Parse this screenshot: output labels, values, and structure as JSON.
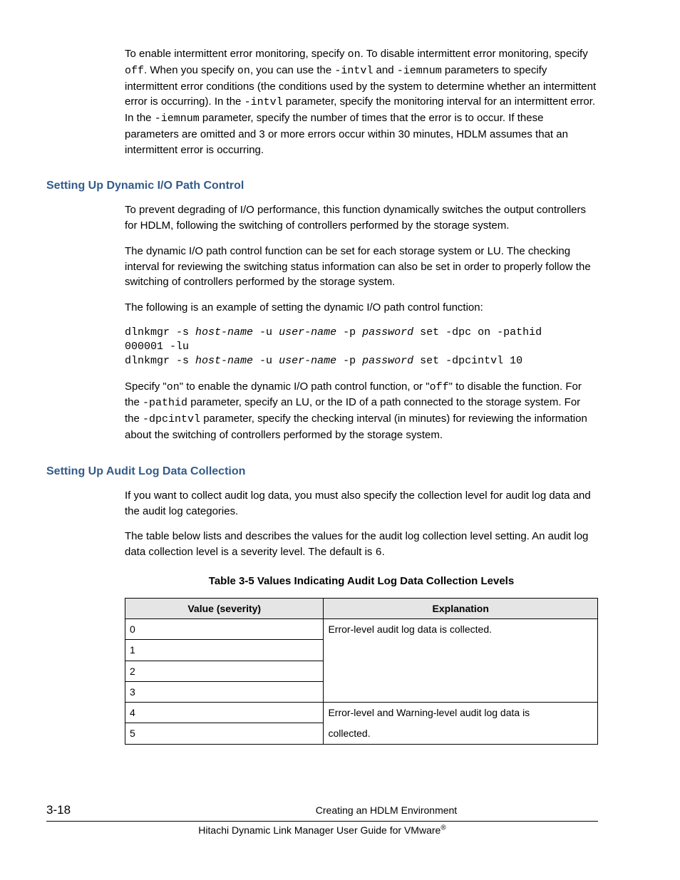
{
  "para1_parts": {
    "t1": "To enable intermittent error monitoring, specify ",
    "c1": "on",
    "t2": ". To disable intermittent error monitoring, specify ",
    "c2": "off",
    "t3": ". When you specify ",
    "c3": "on",
    "t4": ", you can use the ",
    "c4": "-intvl",
    "t5": " and ",
    "c5": "-iemnum",
    "t6": " parameters to specify intermittent error conditions (the conditions used by the system to determine whether an intermittent error is occurring). In the ",
    "c6": "-intvl",
    "t7": " parameter, specify the monitoring interval for an intermittent error. In the ",
    "c7": "-iemnum",
    "t8": " parameter, specify the number of times that the error is to occur. If these parameters are omitted and 3 or more errors occur within 30 minutes, HDLM assumes that an intermittent error is occurring."
  },
  "sec1": {
    "heading": "Setting Up Dynamic I/O Path Control",
    "p1": "To prevent degrading of I/O performance, this function dynamically switches the output controllers for HDLM, following the switching of controllers performed by the storage system.",
    "p2": "The dynamic I/O path control function can be set for each storage system or LU. The checking interval for reviewing the switching status information can also be set in order to properly follow the switching of controllers performed by the storage system.",
    "p3": "The following is an example of setting the dynamic I/O path control function:",
    "code": {
      "l1a": "dlnkmgr -s ",
      "l1b": "host-name",
      "l1c": " -u ",
      "l1d": "user-name",
      "l1e": " -p ",
      "l1f": "password",
      "l1g": " set -dpc on -pathid",
      "l2": "000001 -lu",
      "l3a": "dlnkmgr -s ",
      "l3b": "host-name",
      "l3c": " -u ",
      "l3d": "user-name",
      "l3e": " -p ",
      "l3f": "password",
      "l3g": " set -dpcintvl 10"
    },
    "p4_parts": {
      "t1": "Specify \"",
      "c1": "on",
      "t2": "\" to enable the dynamic I/O path control function, or \"",
      "c2": "off",
      "t3": "\" to disable the function. For the ",
      "c3": "-pathid",
      "t4": " parameter, specify an LU, or the ID of a path connected to the storage system. For the ",
      "c4": "-dpcintvl",
      "t5": " parameter, specify the checking interval (in minutes) for reviewing the information about the switching of controllers performed by the storage system."
    }
  },
  "sec2": {
    "heading": "Setting Up Audit Log Data Collection",
    "p1": "If you want to collect audit log data, you must also specify the collection level for audit log data and the audit log categories.",
    "p2_parts": {
      "t1": "The table below lists and describes the values for the audit log collection level setting. An audit log data collection level is a severity level. The default is ",
      "c1": "6",
      "t2": "."
    },
    "table_caption": "Table 3-5 Values Indicating Audit Log Data Collection Levels",
    "table": {
      "h1": "Value (severity)",
      "h2": "Explanation",
      "r0": "0",
      "r1": "1",
      "r2": "2",
      "r3": "3",
      "r4": "4",
      "r5": "5",
      "exp1": "Error-level audit log data is collected.",
      "exp2a": "Error-level and Warning-level audit log data is",
      "exp2b": "collected."
    }
  },
  "footer": {
    "page": "3-18",
    "chapter": "Creating an HDLM Environment",
    "book": "Hitachi Dynamic Link Manager User Guide for VMware"
  }
}
